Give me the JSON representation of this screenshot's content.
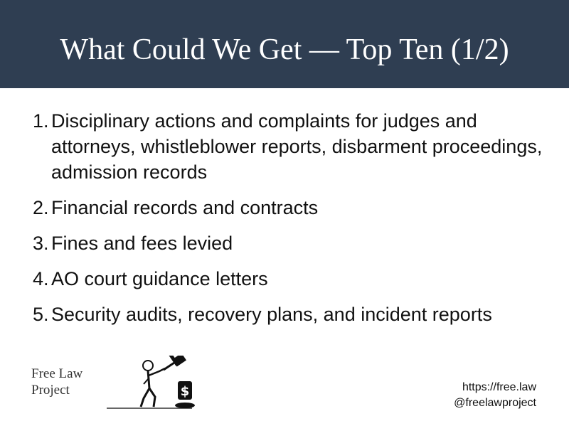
{
  "slide": {
    "title": "What Could We Get — Top Ten (1/2)"
  },
  "items": [
    {
      "number": "1.",
      "text": "Disciplinary actions and complaints for judges and attorneys, whistleblower reports, disbarment proceedings, admission records"
    },
    {
      "number": "2.",
      "text": "Financial records and contracts"
    },
    {
      "number": "3.",
      "text": "Fines and fees levied"
    },
    {
      "number": "4.",
      "text": "AO court guidance letters"
    },
    {
      "number": "5.",
      "text": "Security audits, recovery plans, and incident reports"
    }
  ],
  "logo": {
    "line1": "Free Law",
    "line2": "Project",
    "icon": "gavel-figure-icon"
  },
  "footer": {
    "url": "https://free.law",
    "handle": "@freelawproject"
  },
  "colors": {
    "header_bg": "#2f3e52",
    "title_text": "#ffffff",
    "body_text": "#111111"
  }
}
